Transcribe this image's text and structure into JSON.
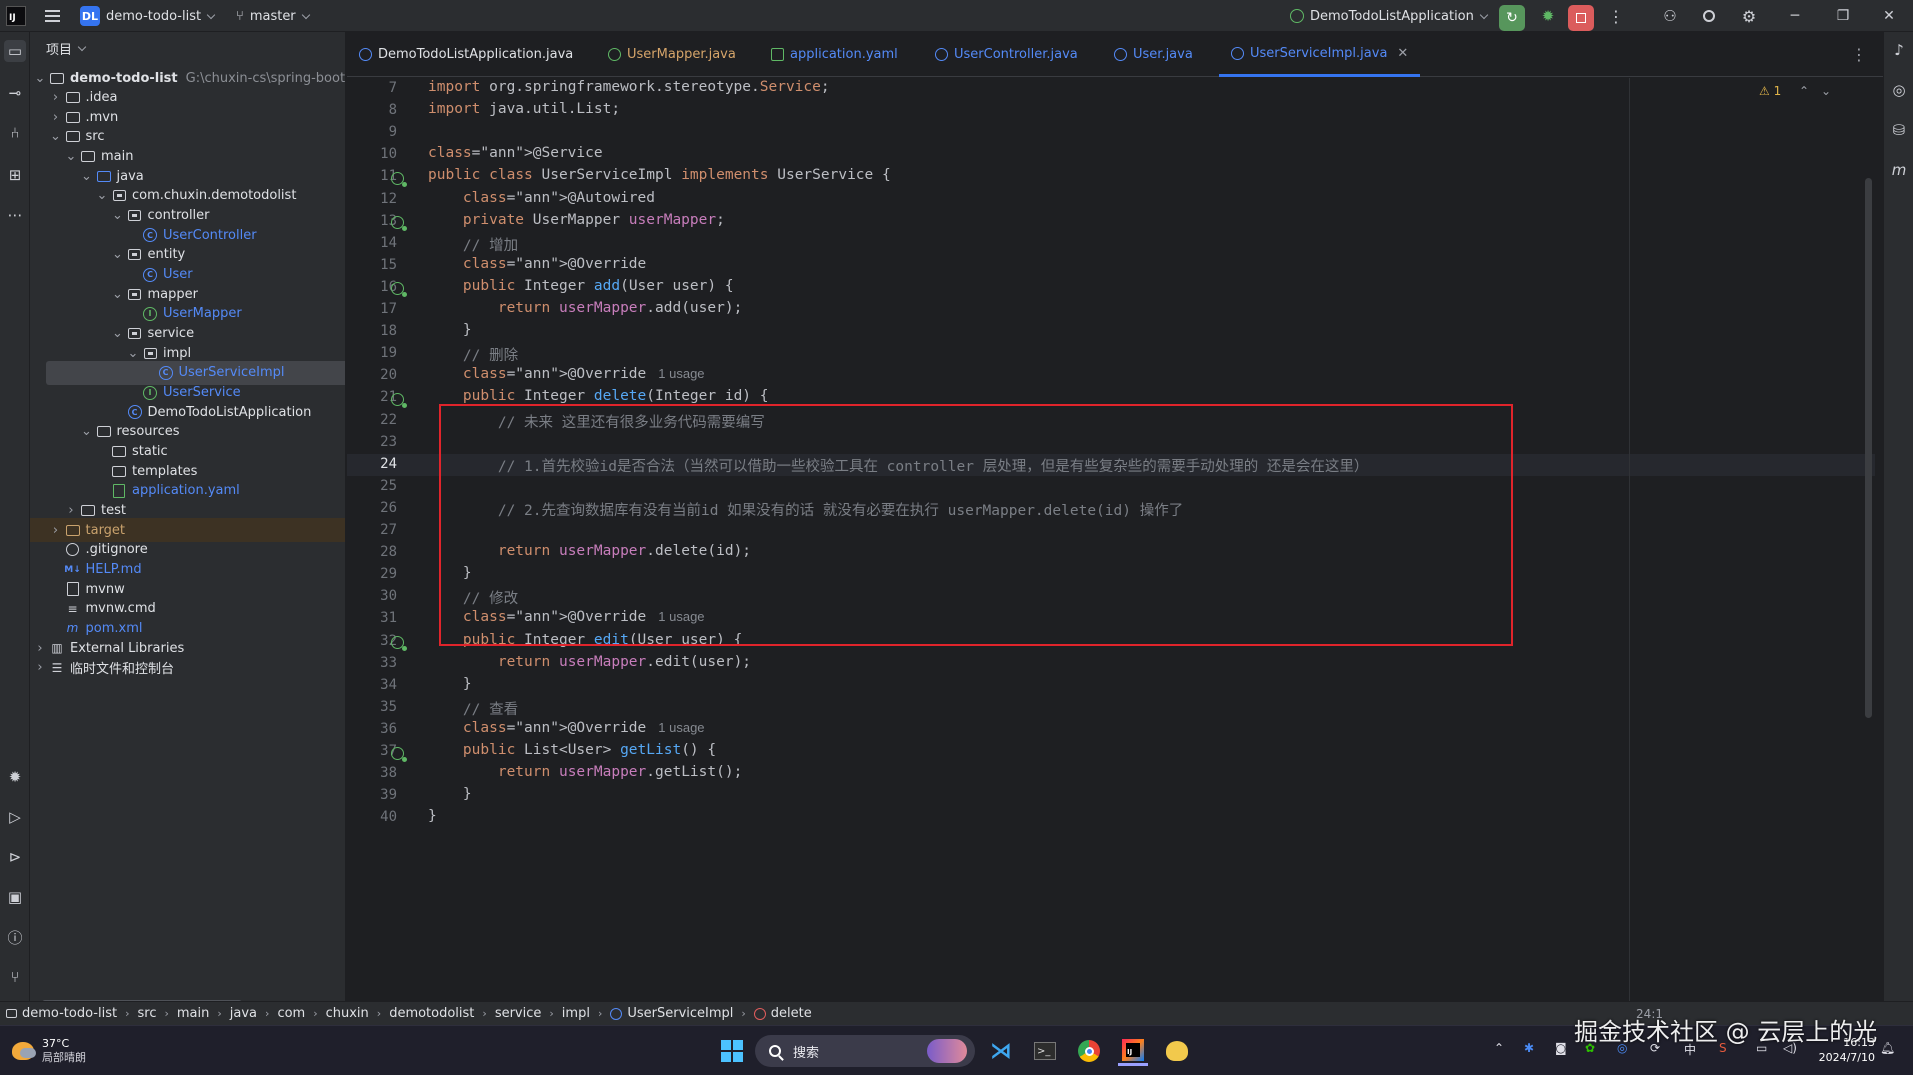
{
  "titlebar": {
    "project_badge": "DL",
    "project_name": "demo-todo-list",
    "branch": "master",
    "run_config": "DemoTodoListApplication"
  },
  "project_panel": {
    "title": "项目",
    "tree": [
      {
        "label": "demo-todo-list",
        "path": "G:\\chuxin-cs\\spring-boot-",
        "depth": 0,
        "icon": "module",
        "expanded": true
      },
      {
        "label": ".idea",
        "depth": 1,
        "icon": "folder",
        "expanded": false
      },
      {
        "label": ".mvn",
        "depth": 1,
        "icon": "folder",
        "expanded": false
      },
      {
        "label": "src",
        "depth": 1,
        "icon": "folder",
        "expanded": true
      },
      {
        "label": "main",
        "depth": 2,
        "icon": "folder",
        "expanded": true
      },
      {
        "label": "java",
        "depth": 3,
        "icon": "folder-blue",
        "expanded": true
      },
      {
        "label": "com.chuxin.demotodolist",
        "depth": 4,
        "icon": "package",
        "expanded": true
      },
      {
        "label": "controller",
        "depth": 5,
        "icon": "package",
        "expanded": true
      },
      {
        "label": "UserController",
        "depth": 6,
        "icon": "class"
      },
      {
        "label": "entity",
        "depth": 5,
        "icon": "package",
        "expanded": true
      },
      {
        "label": "User",
        "depth": 6,
        "icon": "class"
      },
      {
        "label": "mapper",
        "depth": 5,
        "icon": "package",
        "expanded": true
      },
      {
        "label": "UserMapper",
        "depth": 6,
        "icon": "interface"
      },
      {
        "label": "service",
        "depth": 5,
        "icon": "package",
        "expanded": true
      },
      {
        "label": "impl",
        "depth": 6,
        "icon": "package",
        "expanded": true
      },
      {
        "label": "UserServiceImpl",
        "depth": 7,
        "icon": "class",
        "selected": true
      },
      {
        "label": "UserService",
        "depth": 6,
        "icon": "interface"
      },
      {
        "label": "DemoTodoListApplication",
        "depth": 5,
        "icon": "class-app"
      },
      {
        "label": "resources",
        "depth": 3,
        "icon": "folder",
        "expanded": true
      },
      {
        "label": "static",
        "depth": 4,
        "icon": "folder"
      },
      {
        "label": "templates",
        "depth": 4,
        "icon": "folder"
      },
      {
        "label": "application.yaml",
        "depth": 4,
        "icon": "yaml"
      },
      {
        "label": "test",
        "depth": 2,
        "icon": "folder",
        "expanded": false
      },
      {
        "label": "target",
        "depth": 1,
        "icon": "folder-orange",
        "expanded": false,
        "excluded": true
      },
      {
        "label": ".gitignore",
        "depth": 1,
        "icon": "gitignore"
      },
      {
        "label": "HELP.md",
        "depth": 1,
        "icon": "markdown"
      },
      {
        "label": "mvnw",
        "depth": 1,
        "icon": "file"
      },
      {
        "label": "mvnw.cmd",
        "depth": 1,
        "icon": "file-lines"
      },
      {
        "label": "pom.xml",
        "depth": 1,
        "icon": "maven"
      },
      {
        "label": "External Libraries",
        "depth": 0,
        "icon": "libraries",
        "expanded": false
      },
      {
        "label": "临时文件和控制台",
        "depth": 0,
        "icon": "scratches",
        "expanded": false
      }
    ]
  },
  "tabs": [
    {
      "label": "DemoTodoListApplication.java",
      "icon": "class-app",
      "color": "default"
    },
    {
      "label": "UserMapper.java",
      "icon": "interface",
      "color": "orange"
    },
    {
      "label": "application.yaml",
      "icon": "yaml",
      "color": "blue"
    },
    {
      "label": "UserController.java",
      "icon": "class",
      "color": "blue"
    },
    {
      "label": "User.java",
      "icon": "class",
      "color": "blue"
    },
    {
      "label": "UserServiceImpl.java",
      "icon": "class",
      "color": "blue",
      "active": true
    }
  ],
  "editor": {
    "warning_count": "1",
    "current_line": 24,
    "lines": [
      {
        "n": "7",
        "t": "import org.springframework.stereotype.Service;"
      },
      {
        "n": "8",
        "t": "import java.util.List;"
      },
      {
        "n": "9",
        "t": ""
      },
      {
        "n": "10",
        "t": "@Service"
      },
      {
        "n": "11",
        "t": "public class UserServiceImpl implements UserService {"
      },
      {
        "n": "12",
        "t": "    @Autowired"
      },
      {
        "n": "13",
        "t": "    private UserMapper userMapper;"
      },
      {
        "n": "14",
        "t": "    // 增加"
      },
      {
        "n": "15",
        "t": "    @Override"
      },
      {
        "n": "16",
        "t": "    public Integer add(User user) {"
      },
      {
        "n": "17",
        "t": "        return userMapper.add(user);"
      },
      {
        "n": "18",
        "t": "    }"
      },
      {
        "n": "19",
        "t": "    // 删除"
      },
      {
        "n": "20",
        "t": "    @Override",
        "hint": "1 usage"
      },
      {
        "n": "21",
        "t": "    public Integer delete(Integer id) {"
      },
      {
        "n": "22",
        "t": "        // 未来 这里还有很多业务代码需要编写"
      },
      {
        "n": "23",
        "t": ""
      },
      {
        "n": "24",
        "t": "        // 1.首先校验id是否合法（当然可以借助一些校验工具在 controller 层处理，但是有些复杂些的需要手动处理的 还是会在这里）"
      },
      {
        "n": "25",
        "t": ""
      },
      {
        "n": "26",
        "t": "        // 2.先查询数据库有没有当前id 如果没有的话 就没有必要在执行 userMapper.delete(id) 操作了"
      },
      {
        "n": "27",
        "t": ""
      },
      {
        "n": "28",
        "t": "        return userMapper.delete(id);"
      },
      {
        "n": "29",
        "t": "    }"
      },
      {
        "n": "30",
        "t": "    // 修改"
      },
      {
        "n": "31",
        "t": "    @Override",
        "hint": "1 usage"
      },
      {
        "n": "32",
        "t": "    public Integer edit(User user) {"
      },
      {
        "n": "33",
        "t": "        return userMapper.edit(user);"
      },
      {
        "n": "34",
        "t": "    }"
      },
      {
        "n": "35",
        "t": "    // 查看"
      },
      {
        "n": "36",
        "t": "    @Override",
        "hint": "1 usage"
      },
      {
        "n": "37",
        "t": "    public List<User> getList() {"
      },
      {
        "n": "38",
        "t": "        return userMapper.getList();"
      },
      {
        "n": "39",
        "t": "    }"
      },
      {
        "n": "40",
        "t": "}"
      }
    ]
  },
  "breadcrumb": [
    "demo-todo-list",
    "src",
    "main",
    "java",
    "com",
    "chuxin",
    "demotodolist",
    "service",
    "impl",
    "UserServiceImpl",
    "delete"
  ],
  "status": {
    "position": "24:1"
  },
  "taskbar": {
    "weather_temp": "37°C",
    "weather_desc": "局部晴朗",
    "search_label": "搜索",
    "ime_label": "中",
    "time": "16:13",
    "date": "2024/7/10"
  },
  "watermark": "掘金技术社区 @ 云层上的光"
}
